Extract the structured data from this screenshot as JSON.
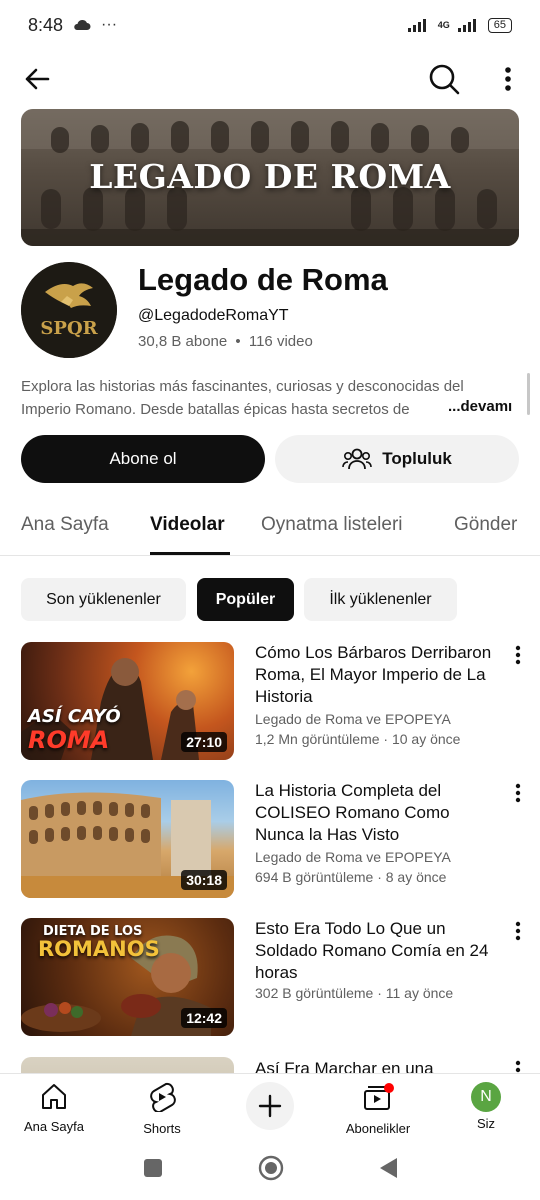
{
  "status_bar": {
    "time": "8:48",
    "dots": "···",
    "network": "4G",
    "battery": "65"
  },
  "banner": {
    "title": "LEGADO DE ROMA"
  },
  "channel": {
    "avatar_text": "SPQR",
    "name": "Legado de Roma",
    "handle": "@LegadodeRomaYT",
    "subscribers": "30,8 B abone",
    "separator": "•",
    "videos": "116 video",
    "description": "Explora las historias más fascinantes, curiosas y desconocidas del Imperio Romano. Desde batallas épicas hasta secretos de",
    "more": "...devamı"
  },
  "buttons": {
    "subscribe": "Abone ol",
    "community": "Topluluk"
  },
  "tabs": [
    {
      "label": "Ana Sayfa"
    },
    {
      "label": "Videolar"
    },
    {
      "label": "Oynatma listeleri"
    },
    {
      "label": "Gönder"
    }
  ],
  "chips": [
    {
      "label": "Son yüklenenler"
    },
    {
      "label": "Popüler"
    },
    {
      "label": "İlk yüklenenler"
    }
  ],
  "videos": [
    {
      "title": "Cómo Los Bárbaros Derribaron Roma, El Mayor Imperio de La Historia",
      "channel": "Legado de Roma ve EPOPEYA",
      "meta": "1,2 Mn görüntüleme · 10 ay önce",
      "duration": "27:10",
      "thumb_text_1": "ASÍ CAYÓ",
      "thumb_text_2": "ROMA"
    },
    {
      "title": "La Historia Completa del COLISEO Romano Como Nunca la Has Visto",
      "channel": "Legado de Roma ve EPOPEYA",
      "meta": "694 B görüntüleme · 8 ay önce",
      "duration": "30:18"
    },
    {
      "title": "Esto Era Todo Lo Que un Soldado Romano Comía en 24 horas",
      "meta": "302 B görüntüleme · 11 ay önce",
      "duration": "12:42",
      "thumb_text_1": "DIETA DE LOS",
      "thumb_text_2": "ROMANOS"
    },
    {
      "title": "Así Fra Marchar en una"
    }
  ],
  "bottom_nav": {
    "home": "Ana Sayfa",
    "shorts": "Shorts",
    "subscriptions": "Abonelikler",
    "you": "Siz",
    "you_initial": "N"
  },
  "colors": {
    "accent": "#0f0f0f",
    "chip_bg": "#f2f2f2",
    "notification": "#ff0000",
    "avatar_you": "#5aa542",
    "gold": "#c9a14a"
  }
}
